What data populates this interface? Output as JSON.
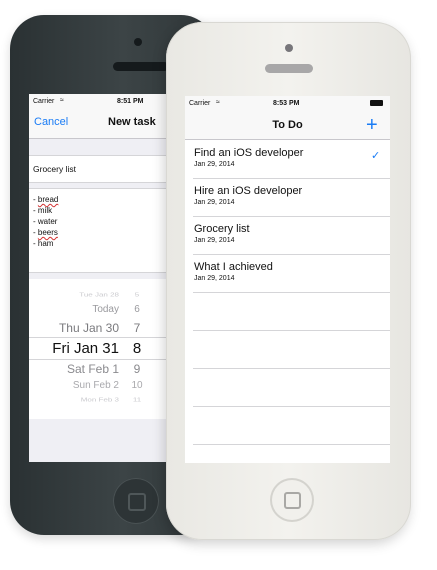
{
  "status": {
    "carrier": "Carrier",
    "wifi_icon": "wifi-icon"
  },
  "back_phone": {
    "time": "8:51 PM",
    "cancel": "Cancel",
    "title": "New task",
    "task_name": "Grocery list",
    "notes": [
      "- bread",
      "- milk",
      "- water",
      "- beers",
      "- ham"
    ],
    "picker": [
      {
        "date": "Tue Jan 28",
        "day": "5"
      },
      {
        "date": "Today",
        "day": "6"
      },
      {
        "date": "Thu Jan 30",
        "day": "7"
      },
      {
        "date": "Fri Jan 31",
        "day": "8"
      },
      {
        "date": "Sat Feb 1",
        "day": "9"
      },
      {
        "date": "Sun Feb 2",
        "day": "10"
      },
      {
        "date": "Mon Feb 3",
        "day": "11"
      }
    ]
  },
  "front_phone": {
    "time": "8:53 PM",
    "title": "To Do",
    "add": "+",
    "check": "✓",
    "tasks": [
      {
        "title": "Find an iOS developer",
        "date": "Jan 29, 2014",
        "checked": true
      },
      {
        "title": "Hire an iOS developer",
        "date": "Jan 29, 2014",
        "checked": false
      },
      {
        "title": "Grocery list",
        "date": "Jan 29, 2014",
        "checked": false
      },
      {
        "title": "What I achieved",
        "date": "Jan 29, 2014",
        "checked": false
      }
    ]
  },
  "colors": {
    "accent": "#1a7cf5",
    "spell_underline": "#d23030"
  }
}
